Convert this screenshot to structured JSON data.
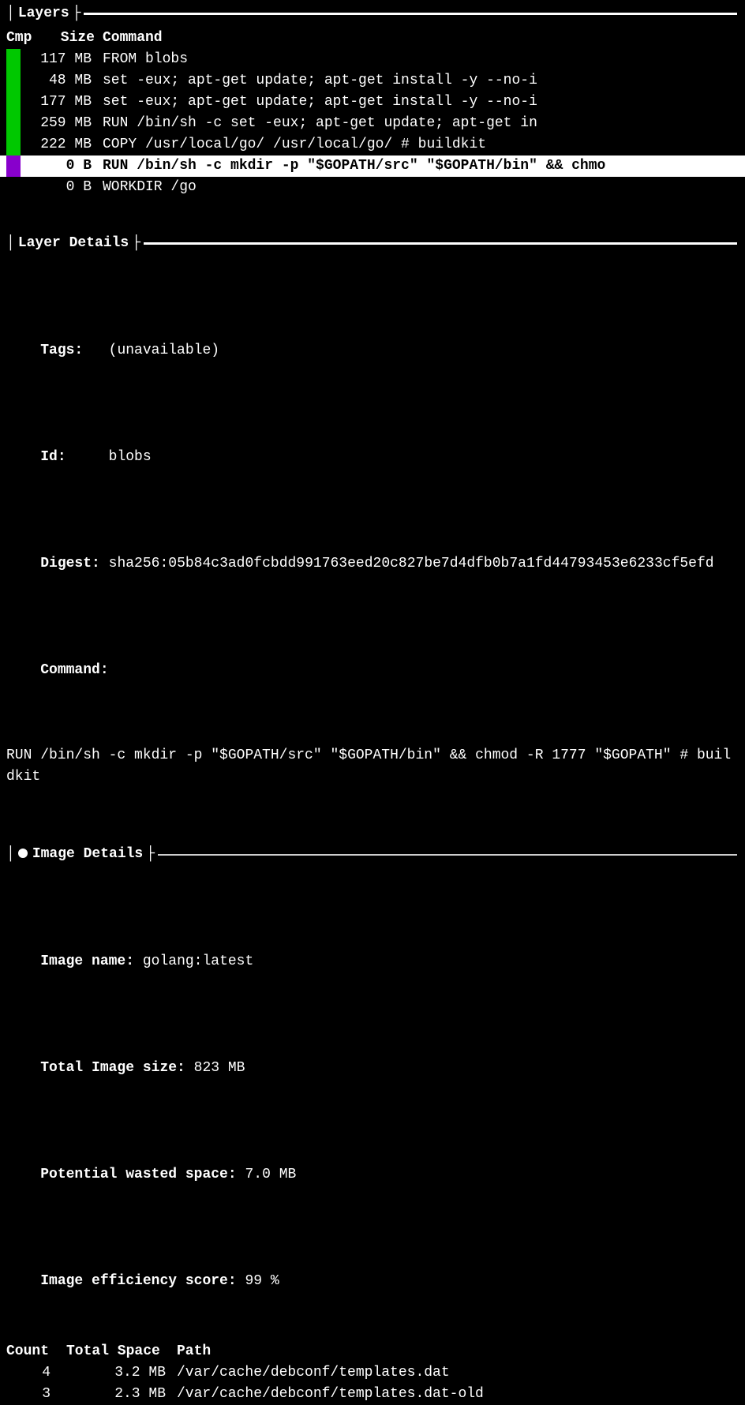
{
  "sections": {
    "layers": "Layers",
    "layer_details": "Layer Details",
    "image_details": "Image Details"
  },
  "layers_table": {
    "headers": {
      "cmp": "Cmp",
      "size": "Size",
      "command": "Command"
    },
    "rows": [
      {
        "cmp": "green",
        "size": "117 MB",
        "command": "FROM blobs",
        "selected": false
      },
      {
        "cmp": "green",
        "size": "48 MB",
        "command": "set -eux;     apt-get update;     apt-get install -y --no-i",
        "selected": false
      },
      {
        "cmp": "green",
        "size": "177 MB",
        "command": "set -eux;     apt-get update;     apt-get install -y --no-i",
        "selected": false
      },
      {
        "cmp": "green",
        "size": "259 MB",
        "command": "RUN /bin/sh -c set -eux;     apt-get update;     apt-get in",
        "selected": false
      },
      {
        "cmp": "green",
        "size": "222 MB",
        "command": "COPY /usr/local/go/ /usr/local/go/ # buildkit",
        "selected": false
      },
      {
        "cmp": "purple",
        "size": "0 B",
        "command": "RUN /bin/sh -c mkdir -p \"$GOPATH/src\" \"$GOPATH/bin\" && chmo",
        "selected": true
      },
      {
        "cmp": "",
        "size": "0 B",
        "command": "WORKDIR /go",
        "selected": false
      }
    ]
  },
  "layer_details": {
    "tags_label": "Tags:",
    "tags_value": "(unavailable)",
    "id_label": "Id:",
    "id_value": "blobs",
    "digest_label": "Digest:",
    "digest_value": "sha256:05b84c3ad0fcbdd991763eed20c827be7d4dfb0b7a1fd44793453e6233cf5efd",
    "command_label": "Command:",
    "command_value": "RUN /bin/sh -c mkdir -p \"$GOPATH/src\" \"$GOPATH/bin\" && chmod -R 1777 \"$GOPATH\" # buildkit"
  },
  "image_details": {
    "name_label": "Image name:",
    "name_value": "golang:latest",
    "total_size_label": "Total Image size:",
    "total_size_value": "823 MB",
    "wasted_label": "Potential wasted space:",
    "wasted_value": "7.0 MB",
    "efficiency_label": "Image efficiency score:",
    "efficiency_value": "99 %"
  },
  "wasted_table": {
    "headers": {
      "count": "Count",
      "space": "Total Space",
      "path": "Path"
    },
    "rows": [
      {
        "count": "4",
        "space": "3.2 MB",
        "path": "/var/cache/debconf/templates.dat"
      },
      {
        "count": "3",
        "space": "2.3 MB",
        "path": "/var/cache/debconf/templates.dat-old"
      }
    ]
  }
}
